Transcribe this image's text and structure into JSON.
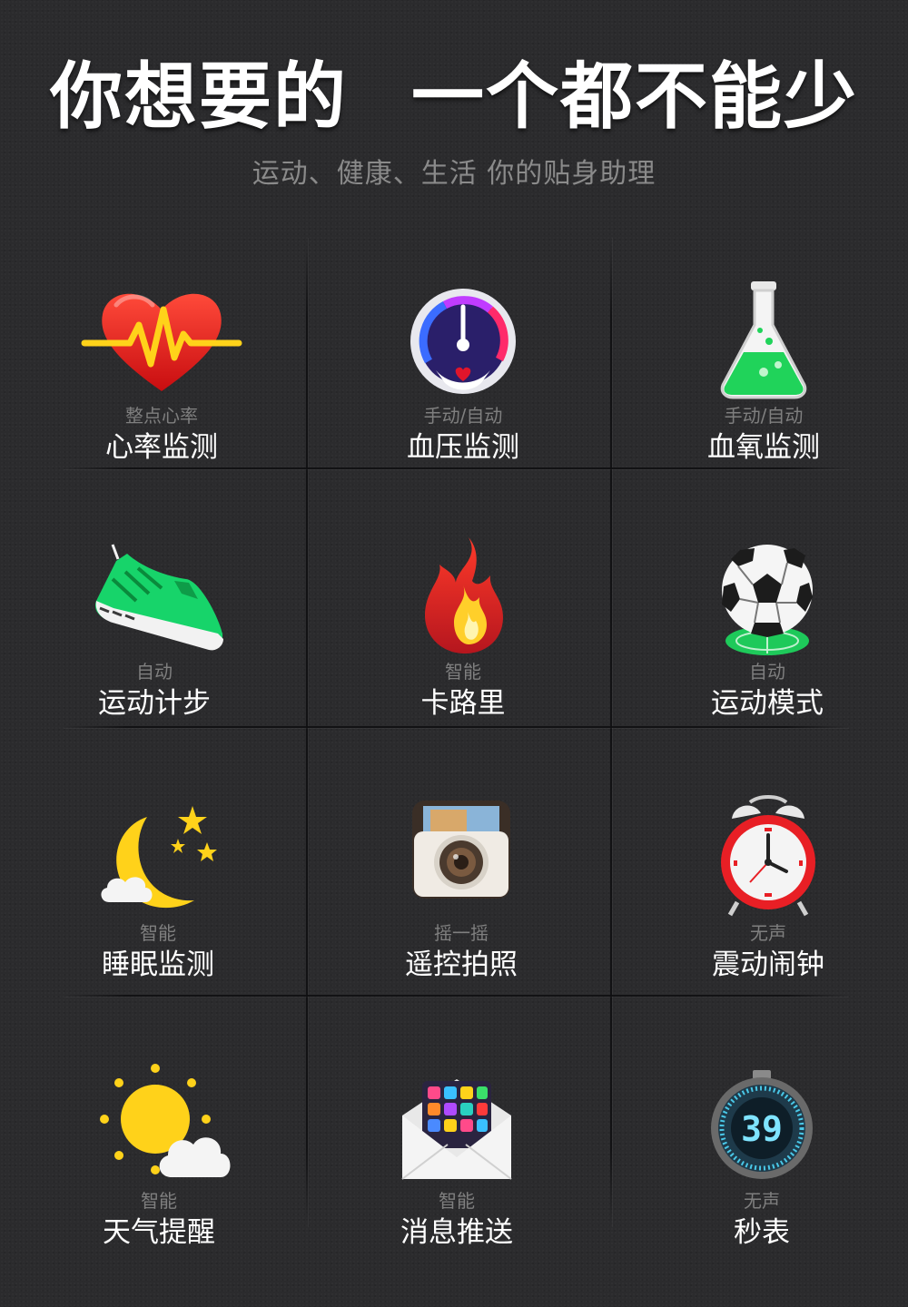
{
  "header": {
    "title_left": "你想要的",
    "title_right": "一个都不能少",
    "subtitle": "运动、健康、生活 你的贴身助理"
  },
  "features": [
    {
      "icon": "heart-rate-icon",
      "small": "整点心率",
      "label": "心率监测"
    },
    {
      "icon": "blood-pressure-gauge-icon",
      "small": "手动/自动",
      "label": "血压监测"
    },
    {
      "icon": "flask-icon",
      "small": "手动/自动",
      "label": "血氧监测"
    },
    {
      "icon": "sneaker-icon",
      "small": "自动",
      "label": "运动计步"
    },
    {
      "icon": "flame-icon",
      "small": "智能",
      "label": "卡路里"
    },
    {
      "icon": "soccer-ball-icon",
      "small": "自动",
      "label": "运动模式"
    },
    {
      "icon": "moon-stars-icon",
      "small": "智能",
      "label": "睡眠监测"
    },
    {
      "icon": "camera-icon",
      "small": "摇一摇",
      "label": "遥控拍照"
    },
    {
      "icon": "alarm-clock-icon",
      "small": "无声",
      "label": "震动闹钟"
    },
    {
      "icon": "sun-cloud-icon",
      "small": "智能",
      "label": "天气提醒"
    },
    {
      "icon": "envelope-apps-icon",
      "small": "智能",
      "label": "消息推送"
    },
    {
      "icon": "stopwatch-icon",
      "small": "无声",
      "label": "秒表",
      "display": "39"
    }
  ]
}
